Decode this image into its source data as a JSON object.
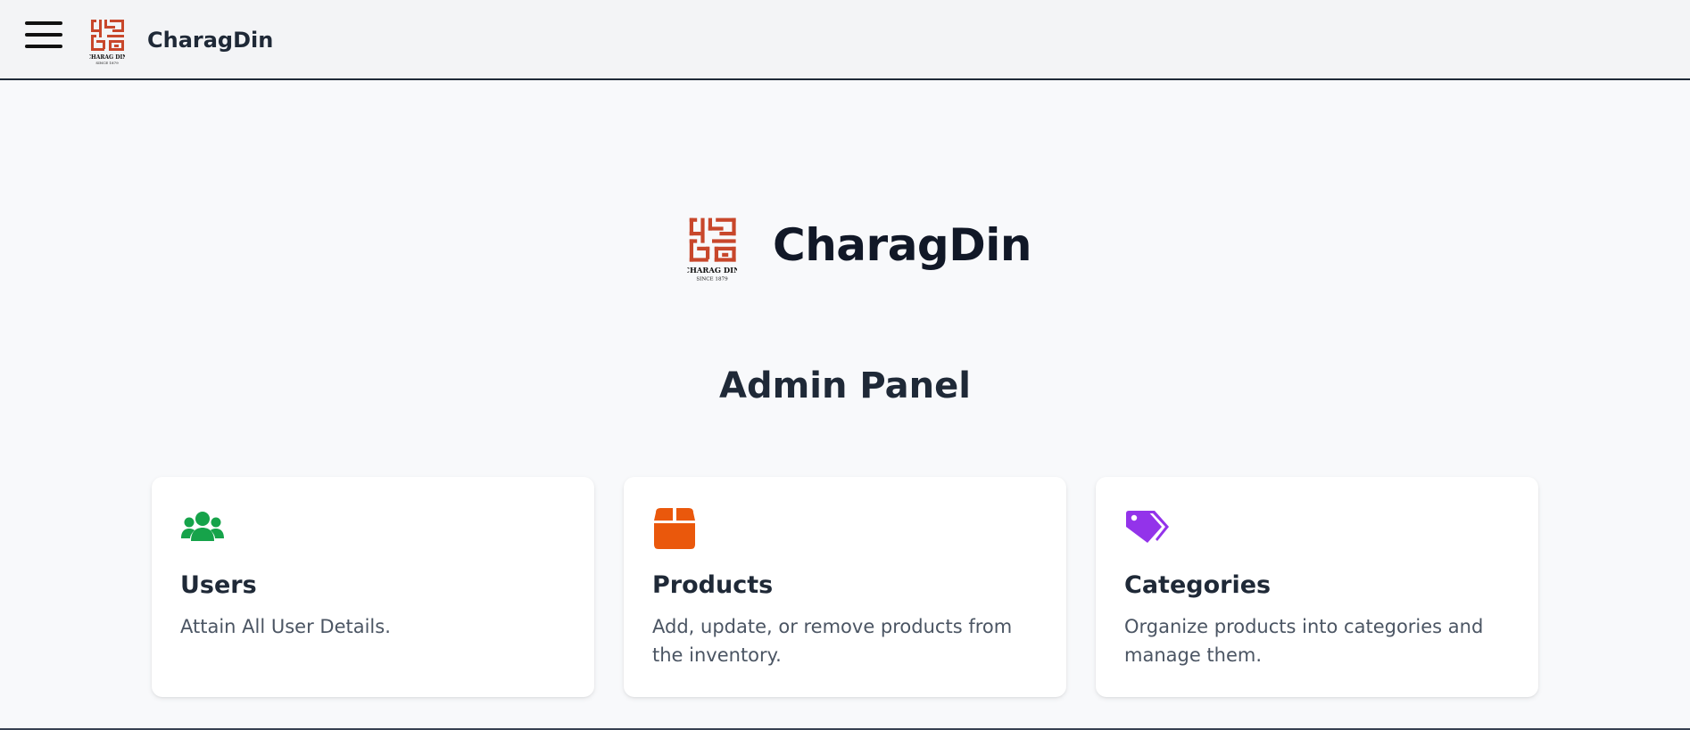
{
  "header": {
    "brand": "CharagDin",
    "logo_text": "CHARAG DIN",
    "logo_since": "SINCE 1879"
  },
  "hero": {
    "brand": "CharagDin"
  },
  "page": {
    "title": "Admin Panel"
  },
  "cards": [
    {
      "title": "Users",
      "description": "Attain All User Details.",
      "icon": "users-icon",
      "color": "#16a34a"
    },
    {
      "title": "Products",
      "description": "Add, update, or remove products from the inventory.",
      "icon": "box-icon",
      "color": "#ea580c"
    },
    {
      "title": "Categories",
      "description": "Organize products into categories and manage them.",
      "icon": "tags-icon",
      "color": "#9333ea"
    }
  ],
  "colors": {
    "logo": "#c8472b",
    "users": "#16a34a",
    "products": "#ea580c",
    "categories": "#9333ea"
  }
}
